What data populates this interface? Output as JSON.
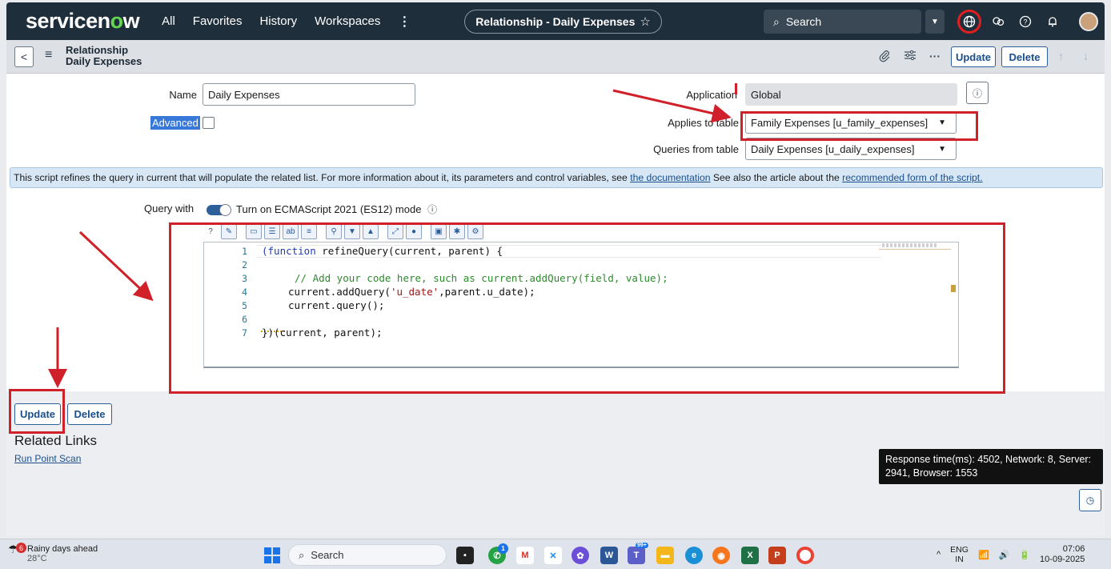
{
  "topnav": {
    "logo_text": "servicenow",
    "links": [
      "All",
      "Favorites",
      "History",
      "Workspaces"
    ],
    "more": "⋮",
    "context_title": "Relationship - Daily Expenses",
    "search_placeholder": "Search"
  },
  "record_header": {
    "type_label": "Relationship",
    "record_name": "Daily Expenses",
    "update_label": "Update",
    "delete_label": "Delete"
  },
  "form": {
    "name_label": "Name",
    "name_value": "Daily Expenses",
    "advanced_label": "Advanced",
    "advanced_checked": false,
    "application_label": "Application",
    "application_value": "Global",
    "applies_to_label": "Applies to table",
    "applies_to_value": "Family Expenses [u_family_expenses]",
    "queries_from_label": "Queries from table",
    "queries_from_value": "Daily Expenses [u_daily_expenses]",
    "info_text_1": "This script refines the query in current that will populate the related list. For more information about it, its parameters and control variables, see ",
    "info_link_1": "the documentation",
    "info_text_2": " See also the article about the ",
    "info_link_2": "recommended form of the script.",
    "query_with_label": "Query with",
    "es_mode_label": "Turn on ECMAScript 2021 (ES12) mode",
    "es_mode_on": true
  },
  "editor": {
    "line_numbers": [
      "1",
      "2",
      "3",
      "4",
      "5",
      "6",
      "7"
    ],
    "code": {
      "l1_a": "(function ",
      "l1_b": "refineQuery(current, parent) {",
      "l3": "// Add your code here, such as current.addQuery(field, value);",
      "l4_a": "current.addQuery(",
      "l4_str": "'u_date'",
      "l4_b": ",parent.u_date);",
      "l5": "current.query();",
      "l7": "})(current, parent);"
    }
  },
  "bottom": {
    "update_label": "Update",
    "delete_label": "Delete",
    "related_links_title": "Related Links",
    "related_link_1": "Run Point Scan",
    "response_time": "Response time(ms): 4502, Network: 8, Server: 2941, Browser: 1553"
  },
  "taskbar": {
    "weather_text": "Rainy days ahead",
    "weather_temp": "28°C",
    "weather_badge": "6",
    "search_label": "Search",
    "whatsapp_badge": "1",
    "teams_badge": "99+",
    "lang_1": "ENG",
    "lang_2": "IN",
    "time": "07:06",
    "date": "10-09-2025"
  },
  "colors": {
    "nav_bg": "#1f2e3b",
    "brand_green": "#62d84e",
    "primary_blue": "#1a4f8b",
    "annotation_red": "#d0202a",
    "info_banner_bg": "#d7e7f6"
  }
}
